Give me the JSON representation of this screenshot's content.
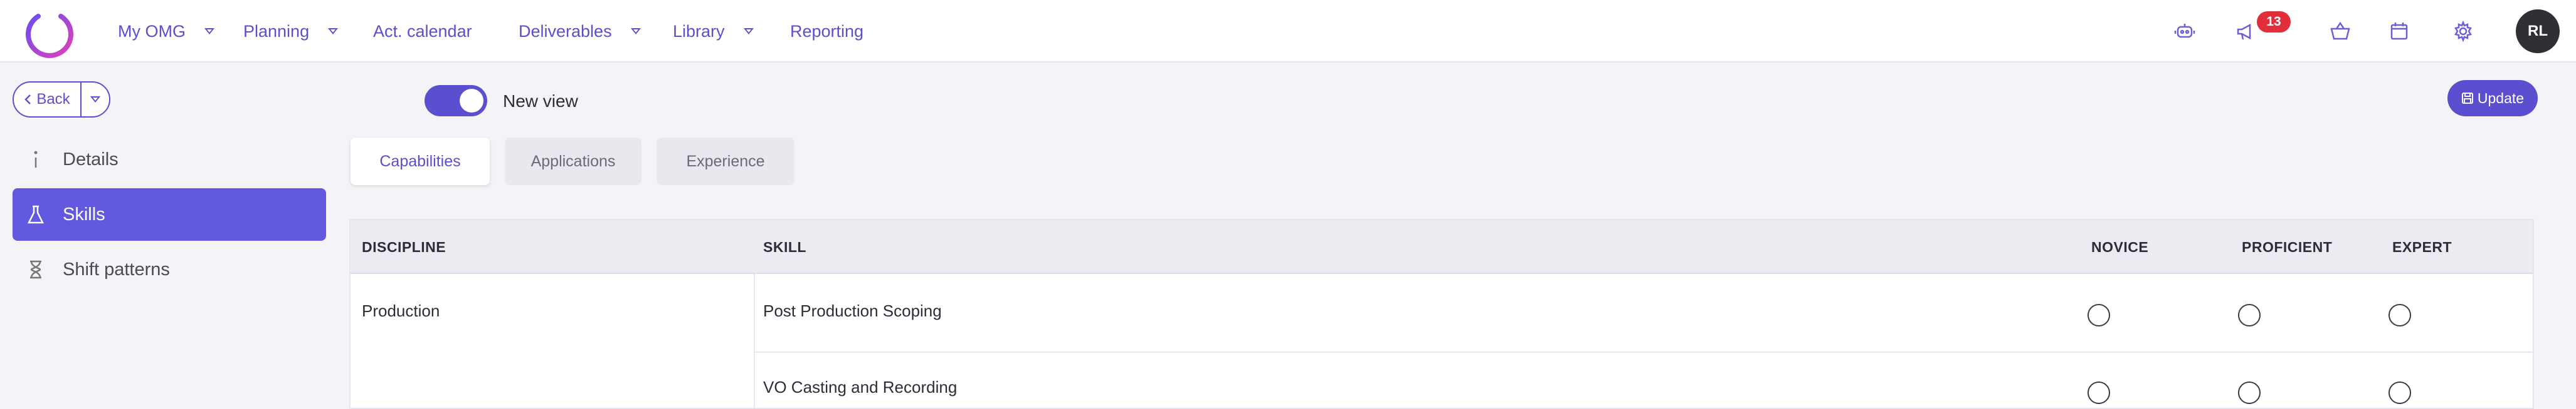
{
  "nav": {
    "items": [
      {
        "label": "My OMG",
        "has_dropdown": true
      },
      {
        "label": "Planning",
        "has_dropdown": true
      },
      {
        "label": "Act. calendar",
        "has_dropdown": false
      },
      {
        "label": "Deliverables",
        "has_dropdown": true
      },
      {
        "label": "Library",
        "has_dropdown": true
      },
      {
        "label": "Reporting",
        "has_dropdown": false
      }
    ],
    "notification_count": "13",
    "avatar_initials": "RL",
    "icons": [
      "robot-icon",
      "megaphone-icon",
      "basket-icon",
      "calendar-icon",
      "gear-icon"
    ]
  },
  "sidebar": {
    "back_label": "Back",
    "items": [
      {
        "label": "Details",
        "icon": "info-icon",
        "active": false
      },
      {
        "label": "Skills",
        "icon": "flask-icon",
        "active": true
      },
      {
        "label": "Shift patterns",
        "icon": "hourglass-icon",
        "active": false
      }
    ]
  },
  "view_toggle": {
    "label": "New view",
    "on": true
  },
  "update_button": {
    "label": "Update"
  },
  "tabs": [
    {
      "label": "Capabilities",
      "active": true
    },
    {
      "label": "Applications",
      "active": false
    },
    {
      "label": "Experience",
      "active": false
    }
  ],
  "table": {
    "headers": [
      "DISCIPLINE",
      "SKILL",
      "NOVICE",
      "PROFICIENT",
      "EXPERT"
    ],
    "rows": [
      {
        "discipline": "Production",
        "skill": "Post Production Scoping"
      },
      {
        "discipline": "",
        "skill": "VO Casting and Recording"
      }
    ]
  },
  "colors": {
    "accent": "#5b4fd0",
    "active_side": "#6259e0",
    "badge": "#e02e3a"
  }
}
